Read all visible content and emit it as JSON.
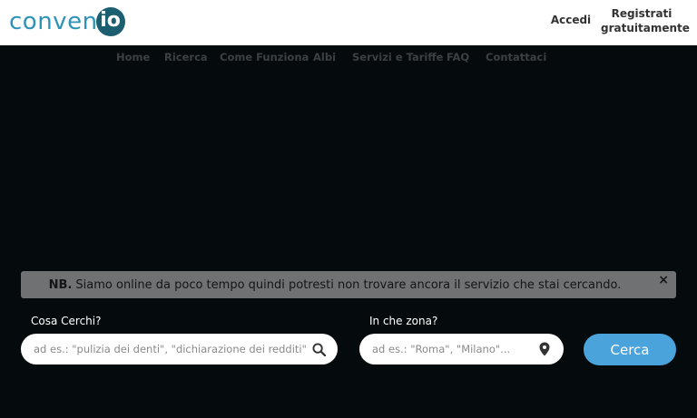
{
  "header": {
    "logo_text": "conven",
    "logo_badge": "io",
    "login_label": "Accedi",
    "register_label_1": "Registrati",
    "register_label_2": "gratuitamente"
  },
  "nav": {
    "items": [
      "Home",
      "Ricerca",
      "Come Funziona",
      "Albi",
      "Servizi e Tariffe",
      "FAQ",
      "Contattaci"
    ]
  },
  "notice": {
    "bold": "NB.",
    "text": "Siamo online da poco tempo quindi potresti non trovare ancora il servizio che stai cercando.",
    "close": "×"
  },
  "search": {
    "what_label": "Cosa Cerchi?",
    "what_placeholder": "ad es.: \"pulizia dei denti\", \"dichiarazione dei redditi\"...",
    "where_label": "In che zona?",
    "where_placeholder": "ad es.: \"Roma\", \"Milano\"...",
    "button_label": "Cerca"
  },
  "colors": {
    "brand_light": "#2f93b7",
    "brand_dark": "#1b5f71",
    "accent_button": "#4ba3dc",
    "background": "#050b0d"
  }
}
